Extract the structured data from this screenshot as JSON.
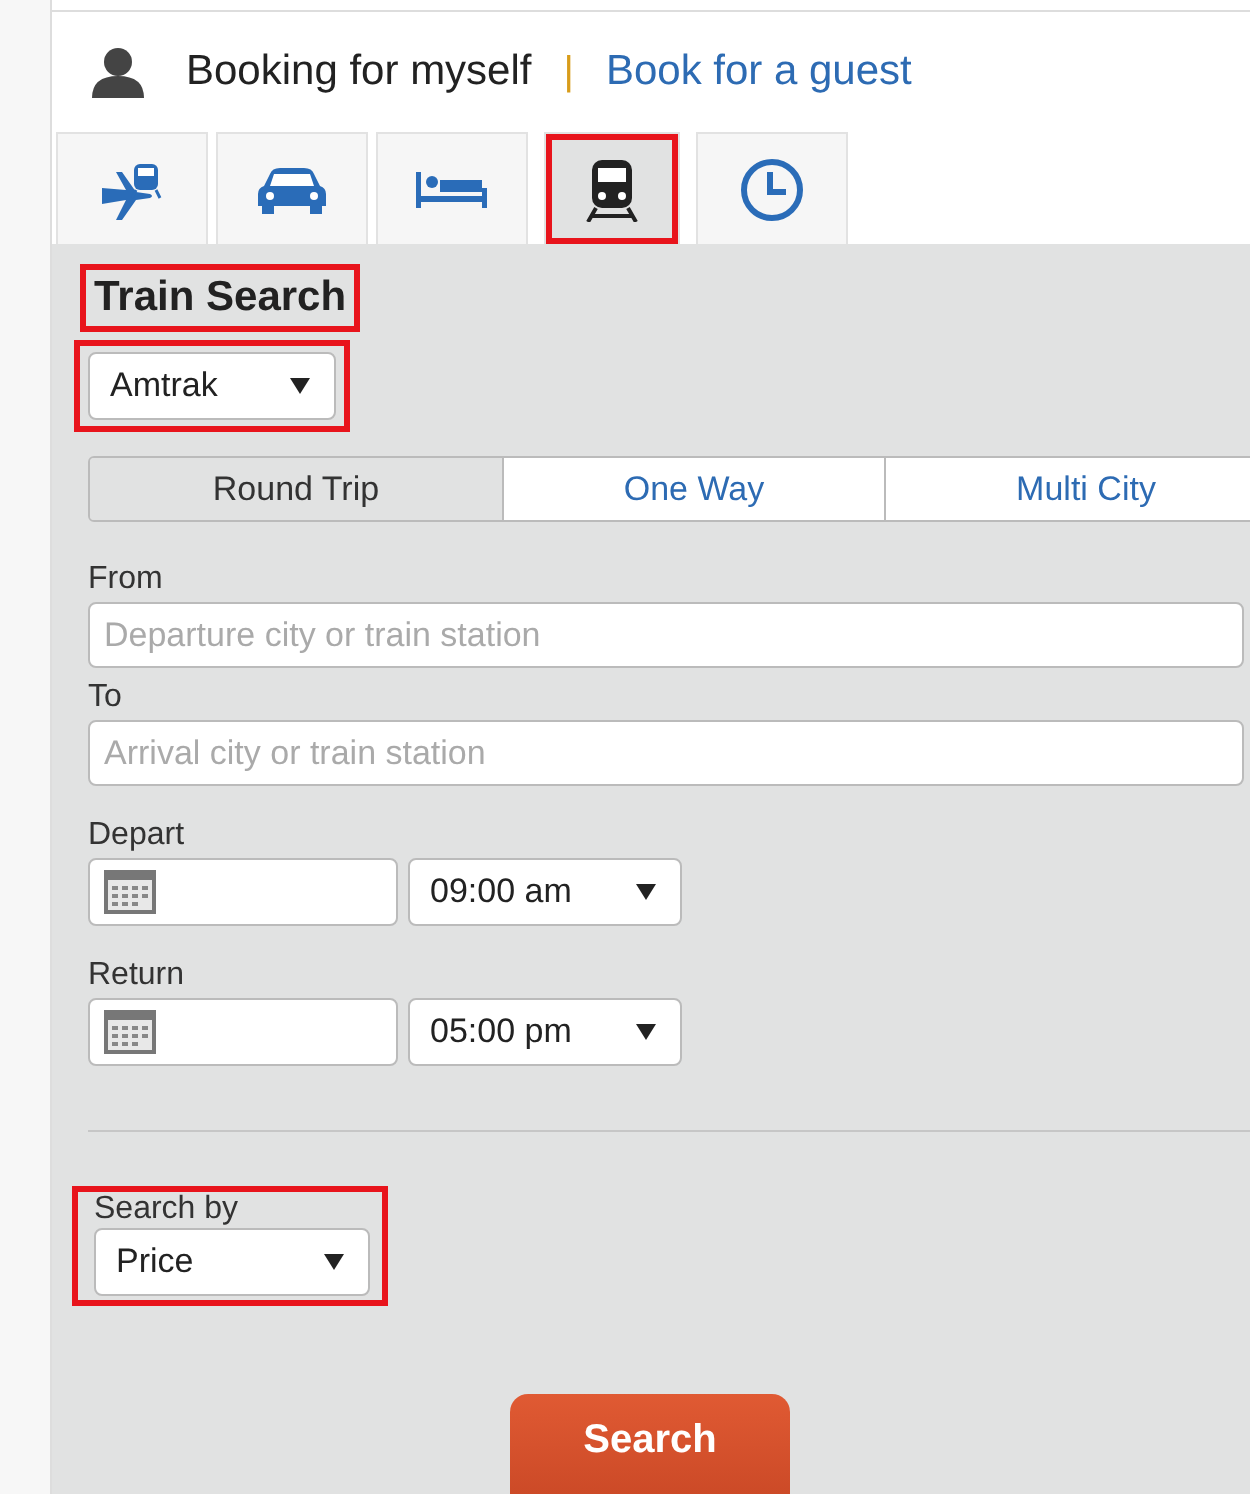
{
  "booking": {
    "self_label": "Booking for myself",
    "separator": "|",
    "guest_link": "Book for a guest"
  },
  "tabs": [
    {
      "kind": "flight-train",
      "selected": false,
      "highlighted": false
    },
    {
      "kind": "car",
      "selected": false,
      "highlighted": false
    },
    {
      "kind": "hotel",
      "selected": false,
      "highlighted": false
    },
    {
      "kind": "train",
      "selected": true,
      "highlighted": true
    },
    {
      "kind": "clock",
      "selected": false,
      "highlighted": false
    }
  ],
  "form": {
    "title": "Train Search",
    "title_highlighted": true,
    "carrier": {
      "value": "Amtrak",
      "highlighted": true
    },
    "trip_types": [
      {
        "label": "Round Trip",
        "selected": true
      },
      {
        "label": "One Way",
        "selected": false
      },
      {
        "label": "Multi City",
        "selected": false
      }
    ],
    "from": {
      "label": "From",
      "placeholder": "Departure city or train station"
    },
    "to": {
      "label": "To",
      "placeholder": "Arrival city or train station"
    },
    "depart": {
      "label": "Depart",
      "time": "09:00 am"
    },
    "return": {
      "label": "Return",
      "time": "05:00 pm"
    },
    "search_by": {
      "label": "Search by",
      "value": "Price",
      "highlighted": true
    },
    "search_button": "Search"
  }
}
